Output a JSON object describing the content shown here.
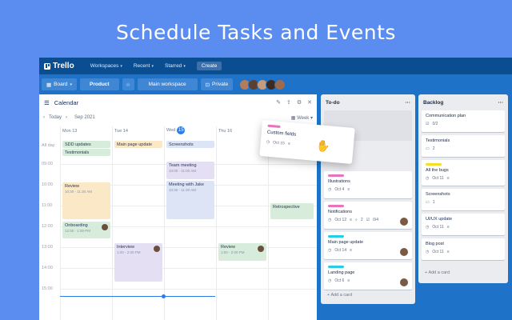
{
  "headline": "Schedule Tasks and Events",
  "nav": {
    "brand": "Trello",
    "workspaces": "Workspaces",
    "recent": "Recent",
    "starred": "Starred",
    "create": "Create"
  },
  "board_bar": {
    "view": "Board",
    "board_name": "Product",
    "workspace": "Main workspace",
    "visibility": "Private"
  },
  "calendar": {
    "title": "Calendar",
    "today": "Today",
    "month": "Sep 2021",
    "view": "Week",
    "days": [
      "Mon 13",
      "Tue 14",
      "Wed",
      "Thu 16"
    ],
    "today_num": "15",
    "allday": "All day",
    "times": [
      "09:00",
      "10:00",
      "11:00",
      "12:00",
      "13:00",
      "14:00",
      "15:00"
    ],
    "events": {
      "sdd": "SDD updates",
      "testimonials": "Testimonials",
      "mainpage": "Main page update",
      "screenshots": "Screenshots",
      "teammeeting": "Team meeting",
      "teammeeting_time": "10:00 - 11:00 AM",
      "meetingwithjake": "Meeting with Jake",
      "meetingwithjake_time": "10:30 - 11:30 AM",
      "review": "Review",
      "review_time": "10:30 - 11:30 AM",
      "onboarding": "Onboarding",
      "onboarding_time": "12:00 - 1:00 PM",
      "interview": "Interview",
      "interview_time": "1:00 - 2:00 PM",
      "retrospective": "Retrospective",
      "review2": "Review",
      "review2_time": "1:00 - 2:00 PM"
    }
  },
  "floating_card": {
    "title": "Custom fields",
    "date": "Oct 15"
  },
  "todo": {
    "title": "To-do",
    "cards": [
      {
        "title": "Illustrations",
        "date": "Oct 4",
        "label_color": "#e774bb"
      },
      {
        "title": "Notifications",
        "date": "Oct 12",
        "attach": "2",
        "checklist": "0/4",
        "label_color": "#e774bb"
      },
      {
        "title": "Main page update",
        "date": "Oct 14",
        "label_color": "#29cce5"
      },
      {
        "title": "Landing page",
        "date": "Oct 6",
        "label_color": "#29cce5"
      }
    ],
    "add": "Add a card"
  },
  "backlog": {
    "title": "Backlog",
    "cards": [
      {
        "title": "Communication plan",
        "meta": "0/2"
      },
      {
        "title": "Testimonials",
        "meta": "2"
      },
      {
        "title": "All the bugs",
        "meta": "Oct 11",
        "label_color": "#f5dd29"
      },
      {
        "title": "Screenshots",
        "meta": "1"
      },
      {
        "title": "UI/UX update",
        "meta": "Oct 11"
      },
      {
        "title": "Blog post",
        "meta": "Oct 11"
      }
    ],
    "add": "Add a card"
  },
  "colors": {
    "page_bg": "#5b8cf0",
    "nav_bg": "#0a4d91",
    "board_bg": "#1e73c8",
    "accent": "#2b7de9"
  }
}
